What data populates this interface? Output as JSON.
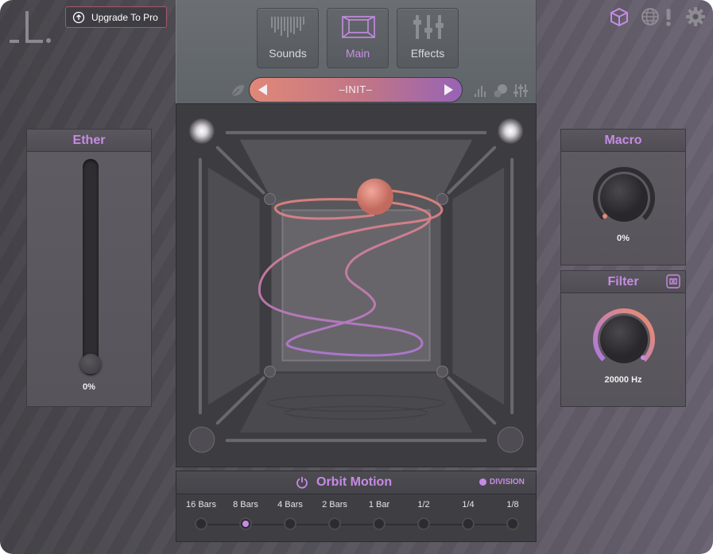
{
  "app": {
    "logo_glyph": "_L."
  },
  "header": {
    "upgrade_label": "Upgrade To Pro",
    "icons": [
      "box-icon",
      "globe-icon",
      "alert-icon",
      "gear-icon"
    ],
    "accent": "#c68be4"
  },
  "tabs": [
    {
      "label": "Sounds",
      "active": false
    },
    {
      "label": "Main",
      "active": true
    },
    {
      "label": "Effects",
      "active": false
    }
  ],
  "preset": {
    "name": "–INIT–"
  },
  "ether": {
    "title": "Ether",
    "value": "0%",
    "level": 0
  },
  "macro": {
    "title": "Macro",
    "value": "0%",
    "level": 0
  },
  "filter": {
    "title": "Filter",
    "value": "20000 Hz",
    "level": 1
  },
  "orbit_motion": {
    "title": "Orbit Motion",
    "division_label": "DIVISION",
    "divisions": [
      "16 Bars",
      "8 Bars",
      "4 Bars",
      "2 Bars",
      "1 Bar",
      "1/2",
      "1/4",
      "1/8"
    ],
    "selected": "8 Bars"
  }
}
